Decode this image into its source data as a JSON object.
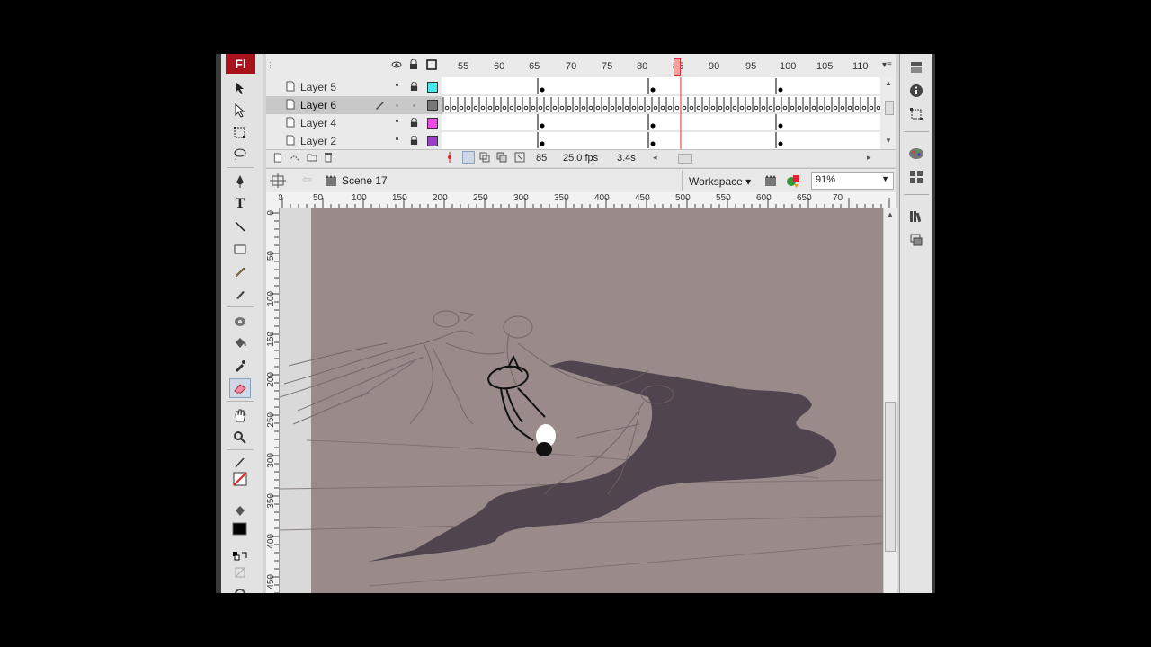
{
  "app": {
    "logo": "Fl"
  },
  "timeline": {
    "frame_numbers": [
      "55",
      "60",
      "65",
      "70",
      "75",
      "80",
      "85",
      "90",
      "95",
      "100",
      "105",
      "110"
    ],
    "layers": [
      {
        "name": "Layer 5",
        "color": "#48e8f0",
        "selected": false
      },
      {
        "name": "Layer 6",
        "color": "#777777",
        "selected": true
      },
      {
        "name": "Layer 4",
        "color": "#f048e8",
        "selected": false
      },
      {
        "name": "Layer 2",
        "color": "#9a40c8",
        "selected": false
      }
    ],
    "current_frame": "85",
    "fps": "25.0 fps",
    "time": "3.4s"
  },
  "editbar": {
    "scene": "Scene 17",
    "workspace": "Workspace",
    "zoom": "91%"
  },
  "ruler": {
    "top_labels": [
      "0",
      "50",
      "100",
      "150",
      "200",
      "250",
      "300",
      "350",
      "400",
      "450",
      "500",
      "550",
      "600",
      "650",
      "70"
    ],
    "left_labels": [
      "0",
      "50",
      "100",
      "150",
      "200",
      "250",
      "300",
      "350",
      "400",
      "450"
    ]
  },
  "colors": {
    "stage": "#9a8a8a",
    "shadow": "#4a3f4a",
    "accent_red": "#a8121a",
    "playhead": "#e03030"
  },
  "icons": {
    "tools": [
      "selection-icon",
      "subselection-icon",
      "free-transform-icon",
      "lasso-icon",
      "pen-icon",
      "text-icon",
      "line-icon",
      "rectangle-icon",
      "pencil-icon",
      "brush-icon",
      "ink-bottle-icon",
      "paint-bucket-icon",
      "eyedropper-icon",
      "eraser-icon",
      "hand-icon",
      "zoom-icon",
      "stroke-color-icon",
      "fill-color-icon"
    ],
    "panels": [
      "properties-icon",
      "info-icon",
      "transform-icon",
      "color-icon",
      "swatches-icon",
      "library-icon",
      "align-icon"
    ]
  }
}
